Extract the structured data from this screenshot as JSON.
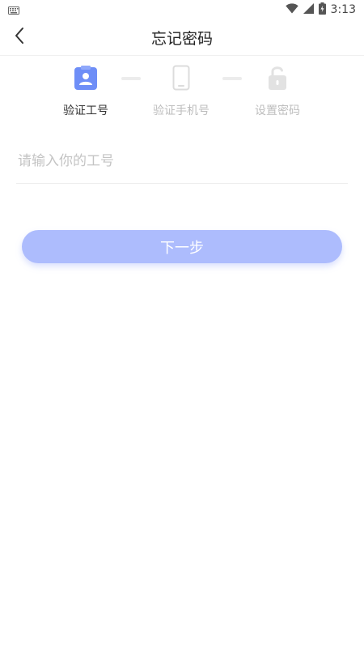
{
  "status_bar": {
    "time": "3:13",
    "icons": [
      "keyboard-icon",
      "wifi-icon",
      "signal-icon",
      "battery-icon"
    ]
  },
  "header": {
    "title": "忘记密码",
    "back_icon": "chevron-left-icon"
  },
  "steps": [
    {
      "label": "验证工号",
      "icon": "id-badge-icon",
      "active": true
    },
    {
      "label": "验证手机号",
      "icon": "phone-icon",
      "active": false
    },
    {
      "label": "设置密码",
      "icon": "lock-icon",
      "active": false
    }
  ],
  "form": {
    "employee_id": {
      "value": "",
      "placeholder": "请输入你的工号"
    }
  },
  "next_button": {
    "label": "下一步"
  },
  "colors": {
    "accent": "#6e8ef7",
    "button": "#adbcfd",
    "inactive": "#bdbdbd",
    "text": "#333333"
  }
}
